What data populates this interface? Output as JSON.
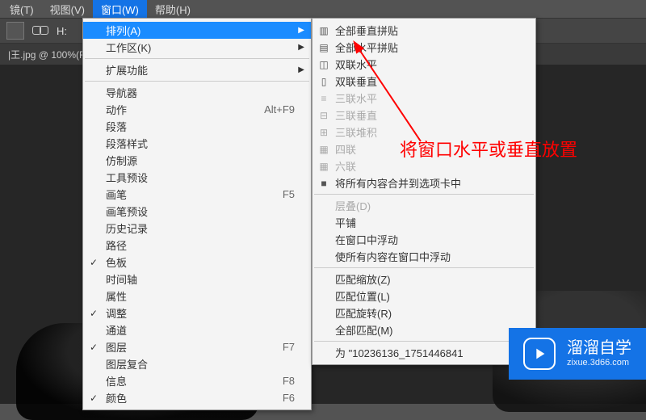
{
  "menubar": {
    "items": [
      {
        "label": "镜(T)"
      },
      {
        "label": "视图(V)"
      },
      {
        "label": "窗口(W)"
      },
      {
        "label": "帮助(H)"
      }
    ],
    "activeIndex": 2
  },
  "toolbar": {
    "letter": "H:"
  },
  "tab": {
    "label": "|王.jpg @ 100%(R"
  },
  "mainMenu": [
    {
      "type": "item",
      "label": "排列(A)",
      "shortcut": "",
      "sub": true,
      "highlight": true
    },
    {
      "type": "item",
      "label": "工作区(K)",
      "shortcut": "",
      "sub": true
    },
    {
      "type": "sep"
    },
    {
      "type": "item",
      "label": "扩展功能",
      "shortcut": "",
      "sub": true
    },
    {
      "type": "sep"
    },
    {
      "type": "item",
      "label": "导航器",
      "shortcut": ""
    },
    {
      "type": "item",
      "label": "动作",
      "shortcut": "Alt+F9"
    },
    {
      "type": "item",
      "label": "段落",
      "shortcut": ""
    },
    {
      "type": "item",
      "label": "段落样式",
      "shortcut": ""
    },
    {
      "type": "item",
      "label": "仿制源",
      "shortcut": ""
    },
    {
      "type": "item",
      "label": "工具预设",
      "shortcut": ""
    },
    {
      "type": "item",
      "label": "画笔",
      "shortcut": "F5"
    },
    {
      "type": "item",
      "label": "画笔预设",
      "shortcut": ""
    },
    {
      "type": "item",
      "label": "历史记录",
      "shortcut": ""
    },
    {
      "type": "item",
      "label": "路径",
      "shortcut": ""
    },
    {
      "type": "item",
      "label": "色板",
      "shortcut": "",
      "checked": true
    },
    {
      "type": "item",
      "label": "时间轴",
      "shortcut": ""
    },
    {
      "type": "item",
      "label": "属性",
      "shortcut": ""
    },
    {
      "type": "item",
      "label": "调整",
      "shortcut": "",
      "checked": true
    },
    {
      "type": "item",
      "label": "通道",
      "shortcut": ""
    },
    {
      "type": "item",
      "label": "图层",
      "shortcut": "F7",
      "checked": true
    },
    {
      "type": "item",
      "label": "图层复合",
      "shortcut": ""
    },
    {
      "type": "item",
      "label": "信息",
      "shortcut": "F8"
    },
    {
      "type": "item",
      "label": "颜色",
      "shortcut": "F6",
      "checked": true
    }
  ],
  "subMenu": [
    {
      "type": "item",
      "glyph": "▥",
      "label": "全部垂直拼贴"
    },
    {
      "type": "item",
      "glyph": "▤",
      "label": "全部水平拼贴"
    },
    {
      "type": "item",
      "glyph": "◫",
      "label": "双联水平"
    },
    {
      "type": "item",
      "glyph": "▯",
      "label": "双联垂直"
    },
    {
      "type": "item",
      "glyph": "≡",
      "label": "三联水平",
      "disabled": true
    },
    {
      "type": "item",
      "glyph": "⊟",
      "label": "三联垂直",
      "disabled": true
    },
    {
      "type": "item",
      "glyph": "⊞",
      "label": "三联堆积",
      "disabled": true
    },
    {
      "type": "item",
      "glyph": "▦",
      "label": "四联",
      "disabled": true
    },
    {
      "type": "item",
      "glyph": "▦",
      "label": "六联",
      "disabled": true
    },
    {
      "type": "item",
      "glyph": "■",
      "label": "将所有内容合并到选项卡中"
    },
    {
      "type": "sep"
    },
    {
      "type": "item",
      "label": "层叠(D)",
      "disabled": true
    },
    {
      "type": "item",
      "label": "平铺"
    },
    {
      "type": "item",
      "label": "在窗口中浮动"
    },
    {
      "type": "item",
      "label": "使所有内容在窗口中浮动"
    },
    {
      "type": "sep"
    },
    {
      "type": "item",
      "label": "匹配缩放(Z)"
    },
    {
      "type": "item",
      "label": "匹配位置(L)"
    },
    {
      "type": "item",
      "label": "匹配旋转(R)"
    },
    {
      "type": "item",
      "label": "全部匹配(M)"
    },
    {
      "type": "sep"
    },
    {
      "type": "item",
      "label": "为 \"10236136_1751446841",
      "prefix": "为 "
    }
  ],
  "annotation": {
    "text": "将窗口水平或垂直放置"
  },
  "badge": {
    "line1": "溜溜自学",
    "line2": "zixue.3d66.com"
  }
}
